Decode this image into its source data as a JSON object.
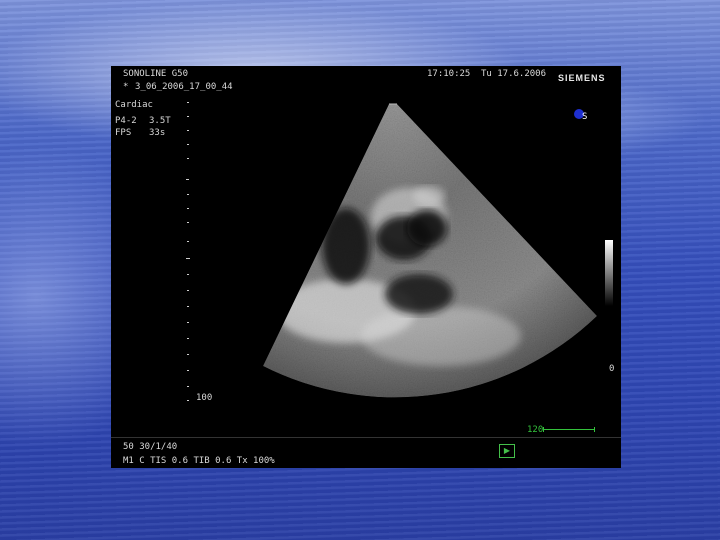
{
  "screen": {
    "device": "SONOLINE G50",
    "patient_id": "3_06_2006_17_00_44",
    "marker": "*",
    "time": "17:10:25",
    "date": "Tu 17.6.2006",
    "brand": "SIEMENS",
    "preset": "Cardiac",
    "probe": "P4-2",
    "frequency": "3.5T",
    "fps_label": "FPS",
    "fps_value": "33s",
    "depth": "100",
    "logo_letter": "S",
    "gray_label": "0",
    "scale_label": "120",
    "footer_line1": "50  30/1/40",
    "footer_line2": "M1  C   TIS 0.6   TIB 0.6   Tx   100%",
    "play_symbol": "▶"
  },
  "colors": {
    "background": "#3650bd",
    "screen": "#000000",
    "accent_green": "#34c23c",
    "logo_blue": "#1e2fd0"
  }
}
